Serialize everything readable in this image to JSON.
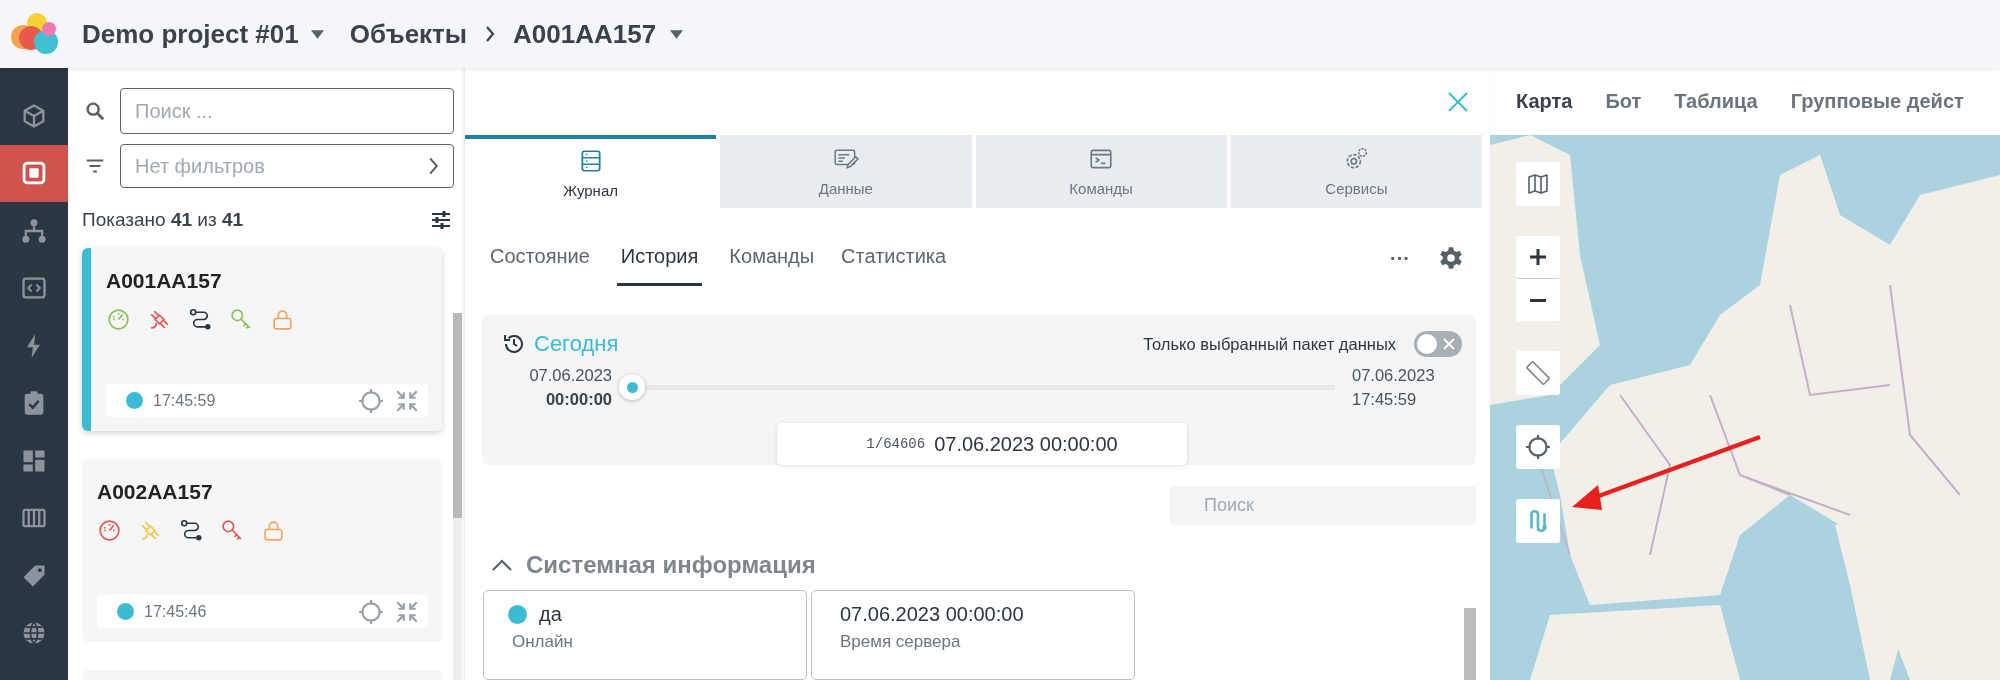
{
  "header": {
    "project": "Demo project #01",
    "breadcrumb": [
      "Объекты",
      "A001AA157"
    ]
  },
  "nav": [
    {
      "selected": false
    },
    {
      "selected": true
    },
    {
      "selected": false
    },
    {
      "selected": false
    },
    {
      "selected": false
    },
    {
      "selected": false
    },
    {
      "selected": false
    },
    {
      "selected": false
    },
    {
      "selected": false
    },
    {
      "selected": false
    }
  ],
  "object_list": {
    "search_placeholder": "Поиск ...",
    "filter_placeholder": "Нет фильтров",
    "count": "Показано **41** из **41**",
    "objects": [
      {
        "name": "A001AA157",
        "selected": true,
        "online": true,
        "time": "17:45:59",
        "indicators": [
          {
            "color": "#8cc152"
          },
          {
            "color": "#e8574f"
          },
          {
            "color": "#2d3640"
          },
          {
            "color": "#8cc152"
          },
          {
            "color": "#f5a45d"
          }
        ]
      },
      {
        "name": "A002AA157",
        "selected": false,
        "online": true,
        "time": "17:45:46",
        "indicators": [
          {
            "color": "#e8574f"
          },
          {
            "color": "#f1c84b"
          },
          {
            "color": "#2d3640"
          },
          {
            "color": "#e8574f"
          },
          {
            "color": "#f5a45d"
          }
        ]
      }
    ]
  },
  "detail": {
    "main_tabs": [
      {
        "label": "Журнал",
        "selected": true
      },
      {
        "label": "Данные",
        "selected": false
      },
      {
        "label": "Команды",
        "selected": false
      },
      {
        "label": "Сервисы",
        "selected": false
      }
    ],
    "sub_tabs": [
      {
        "label": "Состояние",
        "selected": false
      },
      {
        "label": "История",
        "selected": true
      },
      {
        "label": "Команды",
        "selected": false
      },
      {
        "label": "Статистика",
        "selected": false
      }
    ],
    "more": "···",
    "history": {
      "period": "Сегодня",
      "only_selected_label": "Только выбранный пакет данных",
      "only_selected": false,
      "start_date": "07.06.2023",
      "start_time": "00:00:00",
      "end_date": "07.06.2023",
      "end_time": "17:45:59",
      "level": 0,
      "packet_index": "1/64606",
      "packet_time": "07.06.2023 00:00:00"
    },
    "search_placeholder": "Поиск",
    "section": {
      "title": "Системная информация",
      "expanded": true,
      "fields": [
        {
          "kind": "status",
          "on": true,
          "value": "да",
          "label": "Онлайн"
        },
        {
          "kind": "value",
          "value": "07.06.2023 00:00:00",
          "label": "Время сервера"
        }
      ]
    }
  },
  "map": {
    "tabs": [
      {
        "label": "Карта",
        "selected": true
      },
      {
        "label": "Бот",
        "selected": false
      },
      {
        "label": "Таблица",
        "selected": false
      },
      {
        "label": "Групповые дейст",
        "selected": false
      }
    ]
  }
}
